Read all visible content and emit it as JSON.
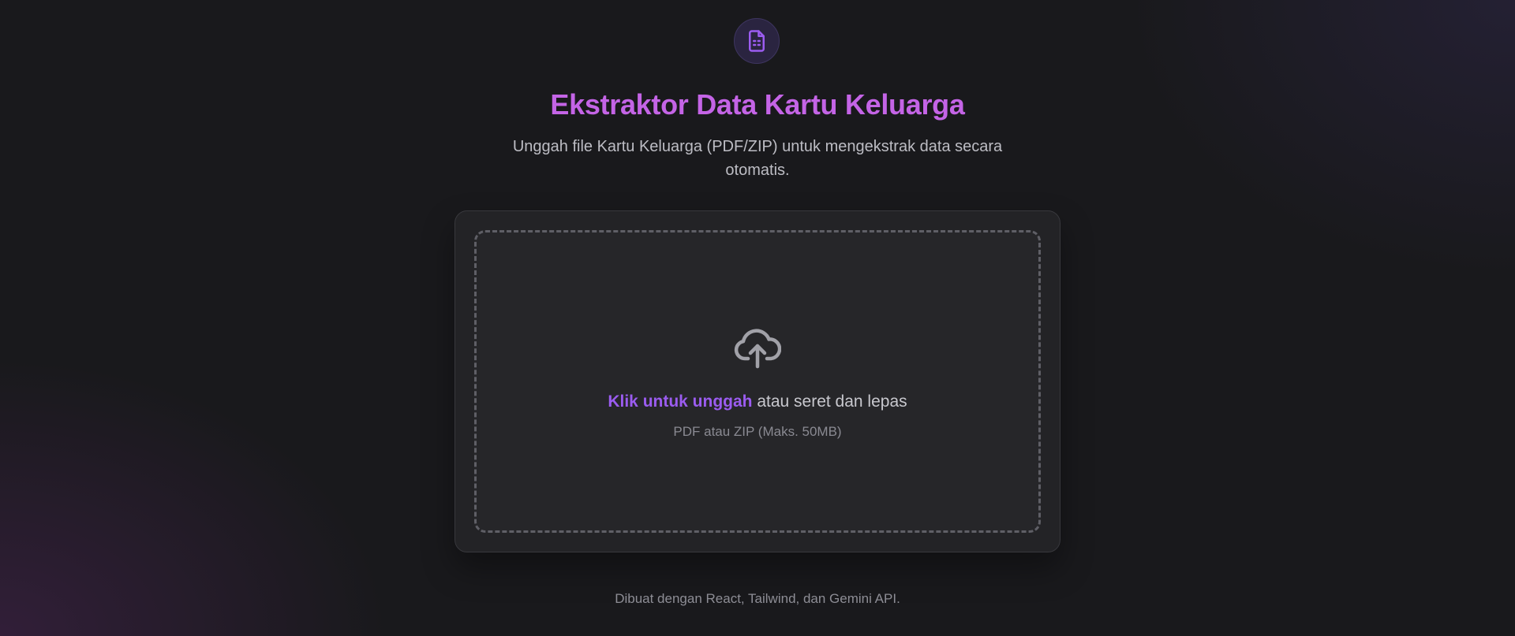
{
  "header": {
    "logo_icon": "document-text-icon",
    "title": "Ekstraktor Data Kartu Keluarga",
    "subtitle": "Unggah file Kartu Keluarga (PDF/ZIP) untuk mengekstrak data secara otomatis."
  },
  "upload": {
    "icon": "cloud-upload-icon",
    "link_label": "Klik untuk unggah",
    "rest_label": " atau seret dan lepas",
    "hint": "PDF atau ZIP (Maks. 50MB)"
  },
  "footer": {
    "text": "Dibuat dengan React, Tailwind, dan Gemini API."
  },
  "colors": {
    "accent": "#9b5cf0",
    "title": "#c464e6",
    "background": "#19191c"
  }
}
